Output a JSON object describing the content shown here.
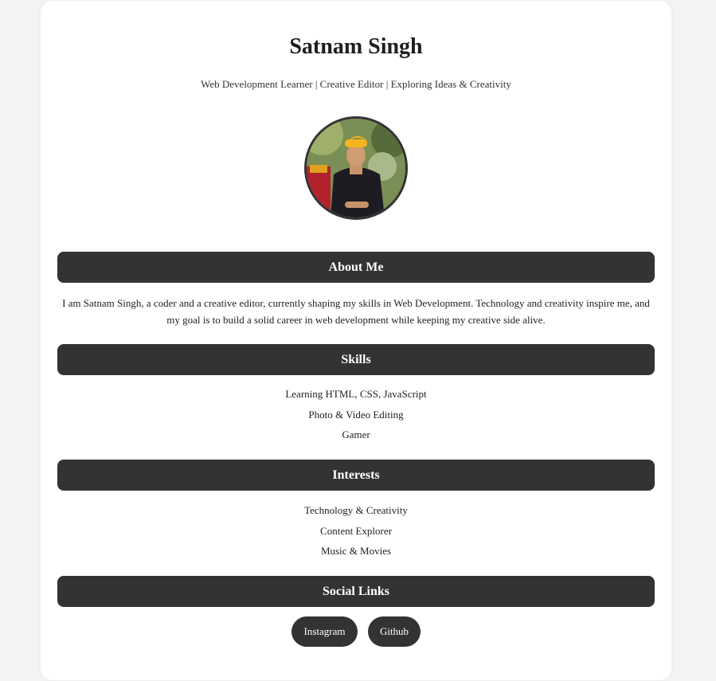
{
  "profile": {
    "name": "Satnam Singh",
    "tagline": "Web Development Learner | Creative Editor | Exploring Ideas & Creativity"
  },
  "about": {
    "heading": "About Me",
    "text": "I am Satnam Singh, a coder and a creative editor, currently shaping my skills in Web Development. Technology and creativity inspire me, and my goal is to build a solid career in web development while keeping my creative side alive."
  },
  "skills": {
    "heading": "Skills",
    "items": [
      "Learning HTML, CSS, JavaScript",
      "Photo & Video Editing",
      "Gamer"
    ]
  },
  "interests": {
    "heading": "Interests",
    "items": [
      "Technology & Creativity",
      "Content Explorer",
      "Music & Movies"
    ]
  },
  "social": {
    "heading": "Social Links",
    "links": [
      "Instagram",
      "Github"
    ]
  },
  "colors": {
    "background": "#f4f4f4",
    "card": "#ffffff",
    "bar": "#333333",
    "text": "#222222"
  }
}
